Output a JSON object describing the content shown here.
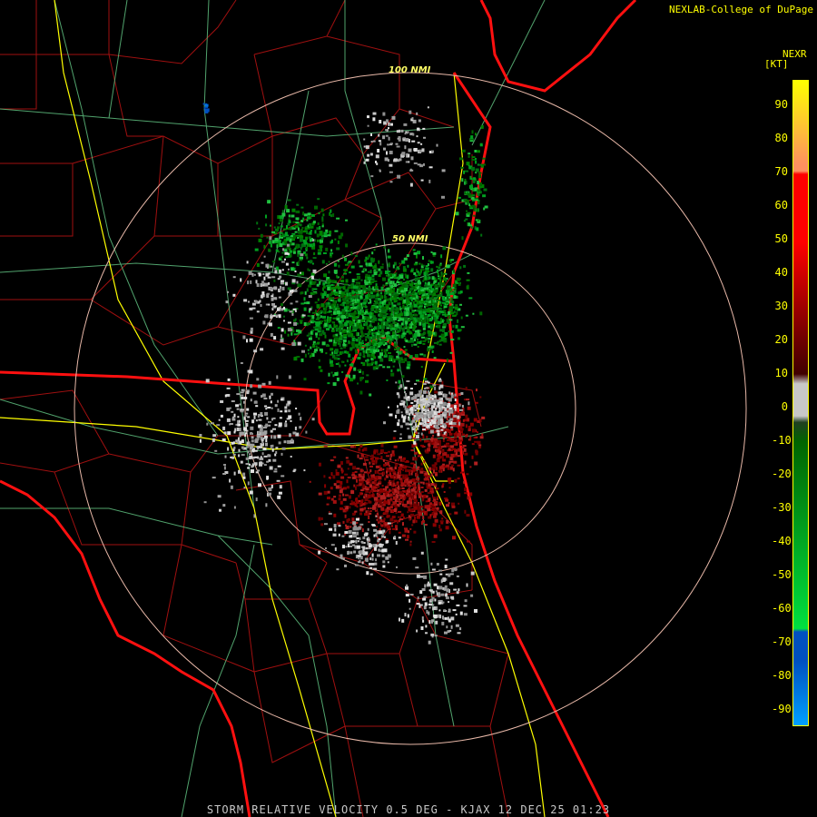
{
  "header": {
    "credit": "NEXLAB-College of DuPage",
    "product_code": "NEXR",
    "units": "[KT]"
  },
  "rings": [
    {
      "label": "100 NMI"
    },
    {
      "label": "50 NMI"
    }
  ],
  "legend": {
    "ticks": [
      "90",
      "80",
      "70",
      "60",
      "50",
      "40",
      "30",
      "20",
      "10",
      "0",
      "-10",
      "-20",
      "-30",
      "-40",
      "-50",
      "-60",
      "-70",
      "-80",
      "-90"
    ],
    "colors": {
      "yellow": "#ffff00",
      "orange": "#ff9060",
      "red": "#ff0000",
      "dark_red": "#700000",
      "gray": "#c8c8c8",
      "dark_green": "#006400",
      "green": "#00e040",
      "blue": "#0050c0",
      "light_blue": "#00a0ff"
    }
  },
  "footer": {
    "caption": "STORM RELATIVE VELOCITY 0.5 DEG - KJAX 12 DEC 25 01:23"
  }
}
